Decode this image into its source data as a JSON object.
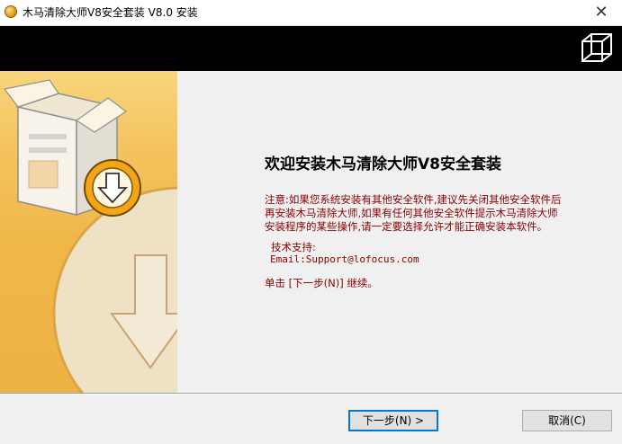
{
  "window": {
    "title": "木马清除大师V8安全套装 V8.0 安装",
    "close_label": "✕"
  },
  "content": {
    "heading": "欢迎安装木马清除大师V8安全套装",
    "note_line1": "注意:如果您系统安装有其他安全软件,建议先关闭其他安全软件后",
    "note_line2": "再安装木马清除大师,如果有任何其他安全软件提示木马清除大师",
    "note_line3": "安装程序的某些操作,请一定要选择允许才能正确安装本软件。",
    "support_label": "技术支持:",
    "support_email": "Email:Support@lofocus.com",
    "instruction": "单击 [下一步(N)] 继续。"
  },
  "buttons": {
    "next": "下一步(N) >",
    "cancel": "取消(C)"
  },
  "colors": {
    "note_text": "#8b0000",
    "banner": "#000000",
    "side_art": "#f0b748"
  }
}
